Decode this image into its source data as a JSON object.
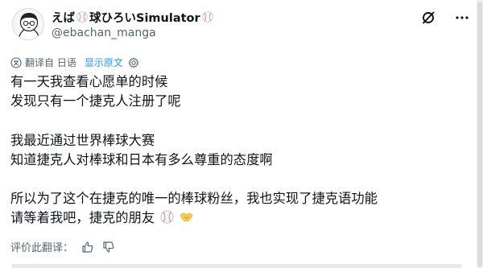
{
  "author": {
    "name": "えば",
    "name_mid": "球ひろいSimulator",
    "handle": "@ebachan_manga"
  },
  "icons": {
    "grok": "grok-icon",
    "more": "more-icon",
    "baseball": "baseball-emoji",
    "handshake": "handshake-emoji",
    "translate": "translate-icon",
    "settings": "gear-icon",
    "thumbs_up": "thumbs-up-icon",
    "thumbs_down": "thumbs-down-icon"
  },
  "translation": {
    "label": "翻译自 日语",
    "show_original": "显示原文"
  },
  "post": {
    "lines": [
      "有一天我查看心愿单的时候",
      "发现只有一个捷克人注册了呢",
      "",
      "我最近通过世界棒球大赛",
      "知道捷克人对棒球和日本有多么尊重的态度啊",
      "",
      "所以为了这个在捷克的唯一的棒球粉丝，我也实现了捷克语功能",
      "请等着我吧，捷克的朋友"
    ]
  },
  "feedback": {
    "label": "评价此翻译："
  },
  "colors": {
    "text": "#0f1419",
    "secondary": "#536471",
    "link": "#1d9bf0",
    "baseball_stitch": "#e0245e"
  }
}
